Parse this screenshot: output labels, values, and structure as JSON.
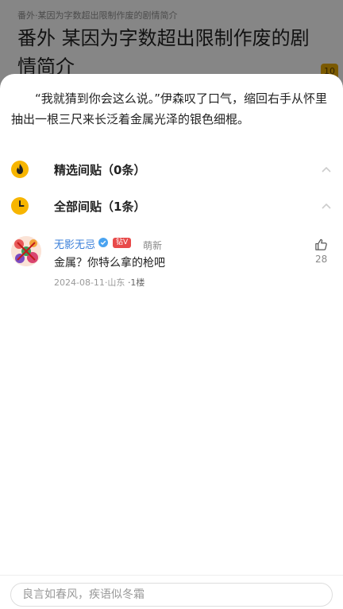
{
  "background": {
    "breadcrumb": "番外·某因为字数超出限制作废的剧情简介",
    "title": "番外 某因为字数超出限制作废的剧情简介",
    "badge": "10"
  },
  "sheet": {
    "quote": "“我就猜到你会这么说。”伊森叹了口气，缩回右手从怀里抽出一根三尺来长泛着金属光泽的银色细棍。",
    "sections": [
      {
        "title": "精选间贴（0条）",
        "icon": "fire-icon"
      },
      {
        "title": "全部间贴（1条）",
        "icon": "clock-icon"
      }
    ],
    "comment": {
      "username": "无影无忌",
      "level_badge": "钻V",
      "user_tag": "萌新",
      "text": "金属？你特么拿的枪吧",
      "date_location": "2024-08-11·山东",
      "floor": "·1楼",
      "likes": "28"
    },
    "input": {
      "placeholder": "良言如春风，疾语似冬霜"
    }
  },
  "colors": {
    "accent_fire": "#f7b500",
    "username_blue": "#3b7fd9",
    "badge_red": "#e84a4a"
  }
}
